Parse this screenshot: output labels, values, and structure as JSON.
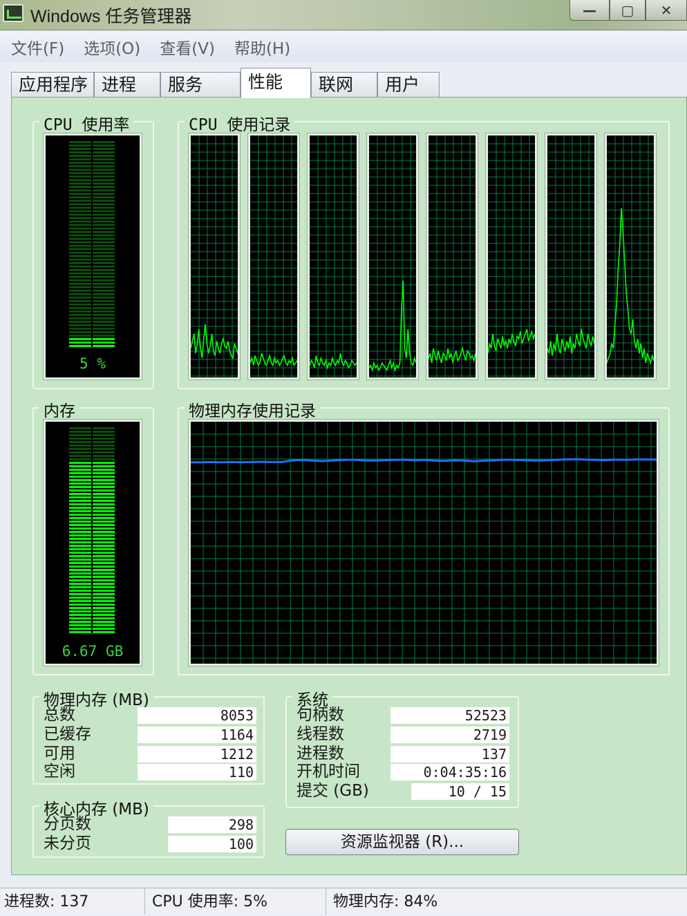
{
  "window": {
    "title": "Windows 任务管理器",
    "buttons": {
      "minimize": "—",
      "maximize": "▢",
      "close": "✕"
    }
  },
  "menu": {
    "items": [
      "文件(F)",
      "选项(O)",
      "查看(V)",
      "帮助(H)"
    ]
  },
  "tabs": {
    "items": [
      "应用程序",
      "进程",
      "服务",
      "性能",
      "联网",
      "用户"
    ],
    "active": "性能"
  },
  "cpu_usage": {
    "title": "CPU 使用率",
    "value": "5 %",
    "level": 0.05
  },
  "cpu_history": {
    "title": "CPU 使用记录",
    "cores": [
      [
        12,
        15,
        18,
        10,
        14,
        20,
        12,
        8,
        16,
        22,
        14,
        10,
        13,
        18,
        11,
        9,
        15,
        12,
        10,
        14,
        16,
        13,
        12,
        15,
        11,
        9,
        8,
        14,
        12,
        10
      ],
      [
        6,
        8,
        5,
        9,
        7,
        5,
        6,
        10,
        8,
        6,
        5,
        7,
        9,
        6,
        5,
        8,
        6,
        7,
        5,
        6,
        8,
        9,
        6,
        5,
        7,
        6,
        8,
        5,
        6,
        7
      ],
      [
        5,
        7,
        6,
        4,
        9,
        6,
        5,
        8,
        6,
        5,
        7,
        4,
        6,
        5,
        8,
        6,
        5,
        7,
        6,
        10,
        6,
        5,
        7,
        6,
        4,
        5,
        7,
        6,
        5,
        6
      ],
      [
        4,
        5,
        3,
        6,
        4,
        5,
        3,
        4,
        6,
        5,
        4,
        3,
        5,
        7,
        4,
        6,
        3,
        5,
        4,
        6,
        28,
        40,
        12,
        8,
        20,
        10,
        6,
        5,
        8,
        6
      ],
      [
        8,
        10,
        6,
        12,
        9,
        7,
        11,
        8,
        6,
        10,
        9,
        7,
        12,
        8,
        10,
        6,
        9,
        11,
        7,
        8,
        10,
        12,
        9,
        7,
        11,
        10,
        8,
        9,
        7,
        10
      ],
      [
        10,
        14,
        12,
        18,
        13,
        11,
        16,
        14,
        12,
        17,
        13,
        15,
        12,
        16,
        14,
        18,
        15,
        13,
        17,
        16,
        19,
        14,
        16,
        18,
        20,
        15,
        17,
        19,
        16,
        18
      ],
      [
        12,
        10,
        15,
        9,
        14,
        11,
        18,
        12,
        10,
        16,
        13,
        11,
        15,
        12,
        17,
        10,
        14,
        12,
        18,
        15,
        13,
        20,
        16,
        14,
        12,
        18,
        15,
        13,
        17,
        14
      ],
      [
        6,
        8,
        10,
        14,
        12,
        22,
        30,
        45,
        55,
        70,
        60,
        48,
        35,
        28,
        20,
        18,
        24,
        15,
        12,
        16,
        10,
        14,
        8,
        12,
        6,
        10,
        8,
        6,
        9,
        7
      ]
    ]
  },
  "memory": {
    "title": "内存",
    "value": "6.67 GB",
    "level": 0.84
  },
  "memory_history": {
    "title": "物理内存使用记录",
    "series": [
      83.2,
      83.2,
      83.3,
      83.2,
      83.3,
      83.2,
      83.3,
      83.4,
      83.3,
      83.3,
      84.0,
      84.2,
      83.9,
      83.7,
      83.9,
      84.2,
      84.3,
      84.0,
      83.9,
      84.1,
      84.2,
      84.3,
      84.0,
      84.2,
      83.9,
      83.8,
      84.0,
      83.9,
      83.6,
      83.9,
      84.0,
      84.3,
      84.2,
      84.1,
      83.9,
      84.0,
      84.2,
      84.4,
      84.5,
      84.3,
      84.2,
      84.1,
      84.3,
      84.2,
      84.4,
      84.4,
      84.3
    ]
  },
  "physical_memory": {
    "title": "物理内存 (MB)",
    "rows": [
      {
        "label": "总数",
        "value": "8053"
      },
      {
        "label": "已缓存",
        "value": "1164"
      },
      {
        "label": "可用",
        "value": "1212"
      },
      {
        "label": "空闲",
        "value": "110"
      }
    ]
  },
  "kernel_memory": {
    "title": "核心内存 (MB)",
    "rows": [
      {
        "label": "分页数",
        "value": "298"
      },
      {
        "label": "未分页",
        "value": "100"
      }
    ]
  },
  "system": {
    "title": "系统",
    "rows": [
      {
        "label": "句柄数",
        "value": "52523"
      },
      {
        "label": "线程数",
        "value": "2719"
      },
      {
        "label": "进程数",
        "value": "137"
      },
      {
        "label": "开机时间",
        "value": "0:04:35:16"
      },
      {
        "label": "提交 (GB)",
        "value": "10 / 15"
      }
    ]
  },
  "resource_monitor_button": "资源监视器 (R)...",
  "statusbar": {
    "processes": "进程数: 137",
    "cpu": "CPU 使用率: 5%",
    "memory": "物理内存: 84%"
  },
  "colors": {
    "panel_bg": "#c7e6c7",
    "grid": "#008040",
    "cpu_line": "#00ff00",
    "memory_line": "#1e6fff",
    "meter_on": "#00ff00",
    "meter_off": "#0b4d0b"
  }
}
